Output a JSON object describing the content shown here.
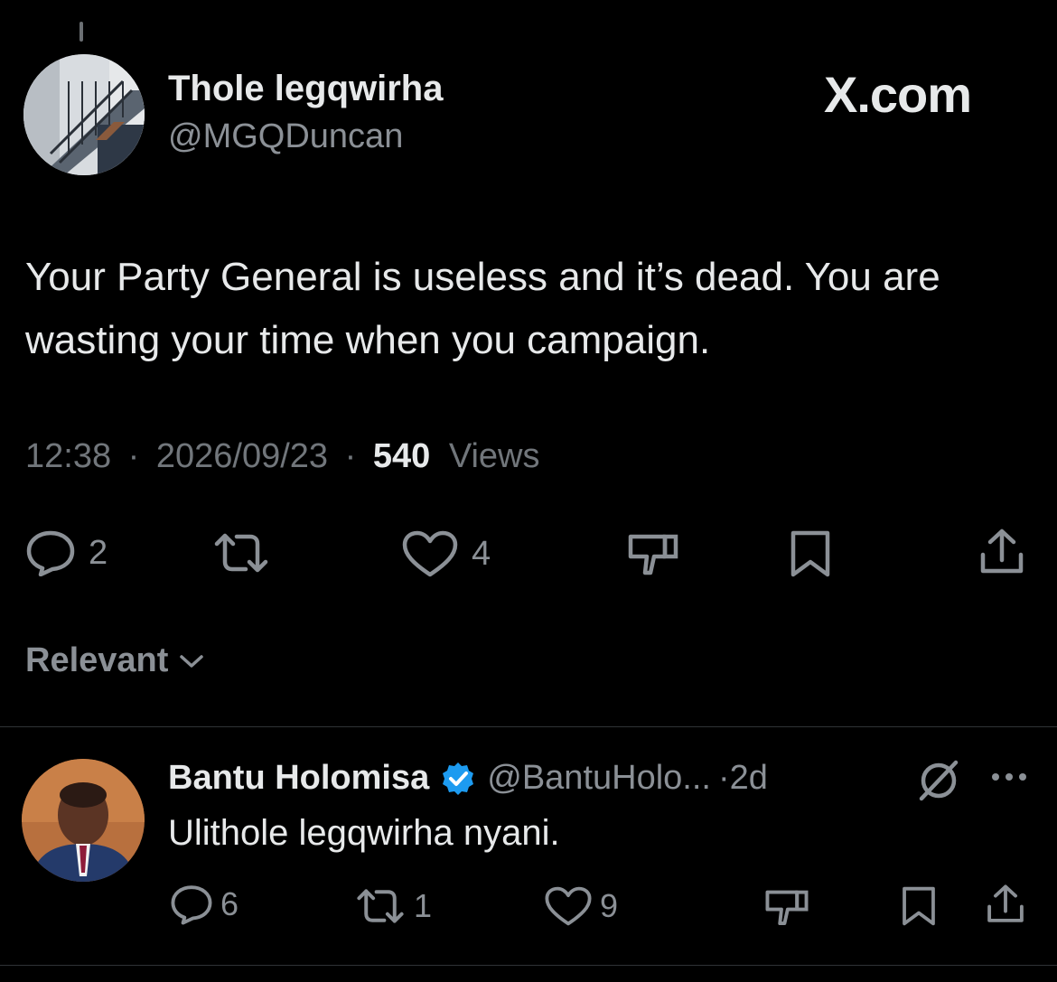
{
  "tweet": {
    "author_name": "Thole legqwirha",
    "author_handle": "@MGQDuncan",
    "brand": "X.com",
    "text": "Your Party General is useless and it’s dead. You are wasting your time when you campaign.",
    "time": "12:38",
    "date": "2026/09/23",
    "views_count": "540",
    "views_label": "Views",
    "separator": "·",
    "actions": {
      "replies": "2",
      "retweets": "",
      "likes": "4"
    }
  },
  "sort": {
    "label": "Relevant"
  },
  "reply": {
    "author_name": "Bantu Holomisa",
    "author_handle": "@BantuHolo...",
    "time_ago": "2d",
    "separator": "·",
    "text": "Ulithole legqwirha nyani.",
    "actions": {
      "replies": "6",
      "retweets": "1",
      "likes": "9"
    }
  },
  "icons": {
    "verified_badge": "verified-badge-icon",
    "reply": "reply-icon",
    "retweet": "retweet-icon",
    "like": "heart-icon",
    "dislike": "thumbs-down-icon",
    "bookmark": "bookmark-icon",
    "share": "share-icon",
    "grok": "grok-icon",
    "more": "more-icon",
    "chevron": "chevron-down-icon"
  },
  "colors": {
    "background": "#000000",
    "primary_text": "#e7e9ea",
    "secondary_text": "#71767b",
    "verified_blue": "#1d9bf0",
    "divider": "#2f3336"
  }
}
